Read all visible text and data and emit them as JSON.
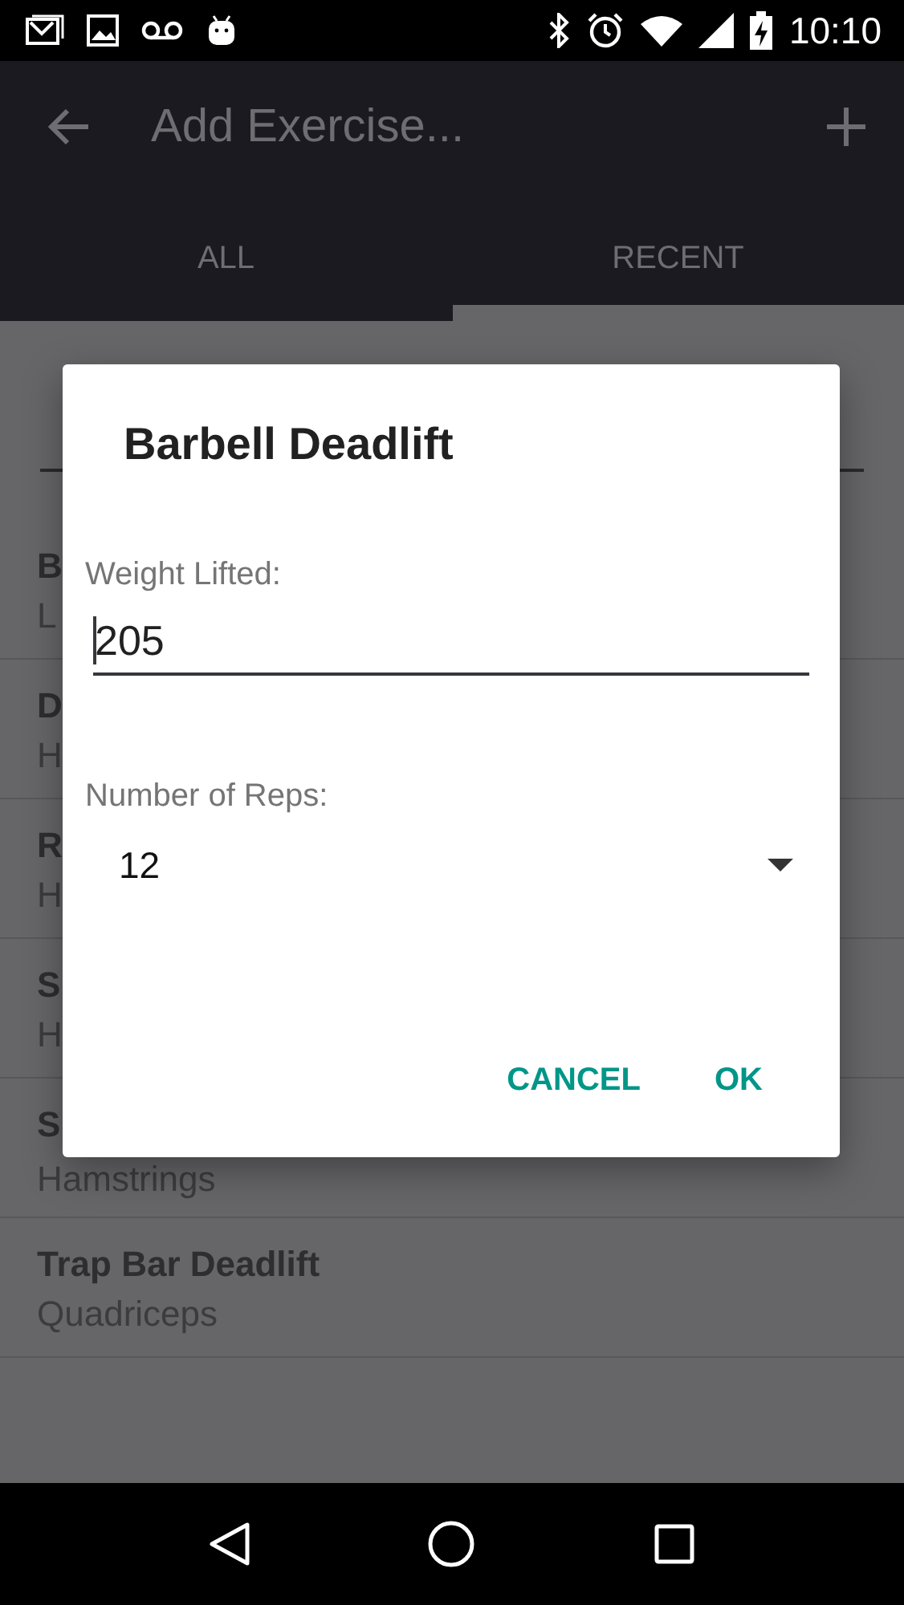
{
  "status_bar": {
    "time": "10:10"
  },
  "app_bar": {
    "title": "Add Exercise..."
  },
  "tabs": [
    {
      "label": "ALL",
      "selected": true
    },
    {
      "label": "RECENT",
      "selected": false
    }
  ],
  "exercises": [
    {
      "name": "B",
      "muscle": "L"
    },
    {
      "name": "D",
      "muscle": "H"
    },
    {
      "name": "R",
      "muscle": "H"
    },
    {
      "name": "S",
      "muscle": "H"
    },
    {
      "name": "S",
      "muscle": "Hamstrings"
    },
    {
      "name": "Trap Bar Deadlift",
      "muscle": "Quadriceps"
    }
  ],
  "dialog": {
    "title": "Barbell Deadlift",
    "fields": [
      {
        "kind": "text",
        "label": "Weight Lifted:",
        "value": "205"
      },
      {
        "kind": "dropdown",
        "label": "Number of Reps:",
        "value": "12"
      }
    ],
    "buttons": [
      "CANCEL",
      "OK"
    ]
  }
}
